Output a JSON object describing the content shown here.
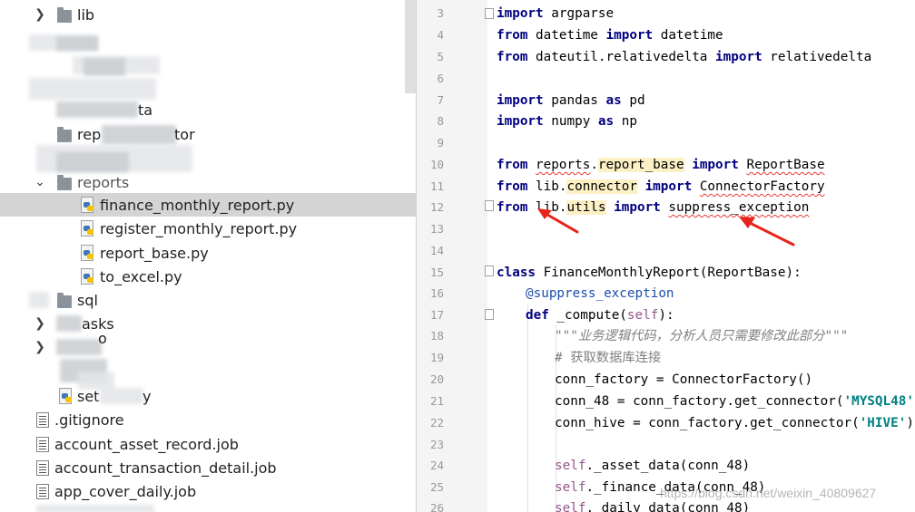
{
  "project_tree": {
    "items": [
      {
        "label": "lib",
        "icon": "folder-icon",
        "chevron": "right"
      },
      {
        "label": "ta",
        "icon": "folder-icon"
      },
      {
        "label": "rep",
        "label_tail": "tor",
        "icon": "folder-icon"
      },
      {
        "label": "reports",
        "icon": "folder-icon",
        "chevron": "down"
      },
      {
        "label": "finance_monthly_report.py",
        "icon": "python-file-icon",
        "selected": true
      },
      {
        "label": "register_monthly_report.py",
        "icon": "python-file-icon"
      },
      {
        "label": "report_base.py",
        "icon": "python-file-icon"
      },
      {
        "label": "to_excel.py",
        "icon": "python-file-icon"
      },
      {
        "label": "sql",
        "icon": "folder-icon"
      },
      {
        "label": "asks",
        "icon": "folder-icon",
        "chevron": "right"
      },
      {
        "label": "o",
        "icon": "folder-icon",
        "chevron": "right"
      },
      {
        "label": "set",
        "label_tail": "y",
        "icon": "python-file-icon"
      },
      {
        "label": ".gitignore",
        "icon": "text-file-icon"
      },
      {
        "label": "account_asset_record.job",
        "icon": "text-file-icon"
      },
      {
        "label": "account_transaction_detail.job",
        "icon": "text-file-icon"
      },
      {
        "label": "app_cover_daily.job",
        "icon": "text-file-icon"
      }
    ]
  },
  "editor": {
    "line_numbers": [
      "3",
      "4",
      "5",
      "6",
      "7",
      "8",
      "9",
      "10",
      "11",
      "12",
      "13",
      "14",
      "15",
      "16",
      "17",
      "18",
      "19",
      "20",
      "21",
      "22",
      "23",
      "24",
      "25",
      "26"
    ],
    "lines": {
      "l3": [
        "import",
        " argparse"
      ],
      "l4": [
        "from",
        " datetime ",
        "import",
        " datetime"
      ],
      "l5": [
        "from",
        " dateutil.relativedelta ",
        "import",
        " relativedelta"
      ],
      "l7": [
        "import",
        " pandas ",
        "as",
        " pd"
      ],
      "l8": [
        "import",
        " numpy ",
        "as",
        " np"
      ],
      "l10": [
        "from",
        " ",
        "reports",
        ".",
        "report_base",
        " ",
        "import",
        " ",
        "ReportBase"
      ],
      "l11": [
        "from",
        " lib.",
        "connector",
        " ",
        "import",
        " ",
        "ConnectorFactory"
      ],
      "l12": [
        "from",
        " lib.",
        "utils",
        " ",
        "import",
        " ",
        "suppress_exception"
      ],
      "l15": [
        "class",
        " FinanceMonthlyReport(ReportBase):"
      ],
      "l16": [
        "@suppress_exception"
      ],
      "l17": [
        "def",
        " _compute(",
        "self",
        "):"
      ],
      "l18": [
        "\"\"\"业务逻辑代码，分析人员只需要修改此部分\"\"\""
      ],
      "l19": [
        "# 获取数据库连接"
      ],
      "l20": [
        "conn_factory = ConnectorFactory()"
      ],
      "l21": [
        "conn_48 = conn_factory.get_connector(",
        "'MYSQL48'",
        ")"
      ],
      "l22": [
        "conn_hive = conn_factory.get_connector(",
        "'HIVE'",
        ")"
      ],
      "l24": [
        "self",
        "._asset_data(conn_48)"
      ],
      "l25": [
        "self",
        "._finance_data(conn_48)"
      ],
      "l26": [
        "self",
        "._daily_data(conn_48)"
      ]
    }
  },
  "annotations": {
    "arrow_color": "#e8231c",
    "arrows": 2
  },
  "watermark": "https://blog.csdn.net/weixin_40809627",
  "colors": {
    "keyword": "#000080",
    "string": "#008080",
    "self": "#94558d",
    "comment": "#808080",
    "highlight": "#fcf0c5",
    "selection": "#d4d4d4"
  }
}
